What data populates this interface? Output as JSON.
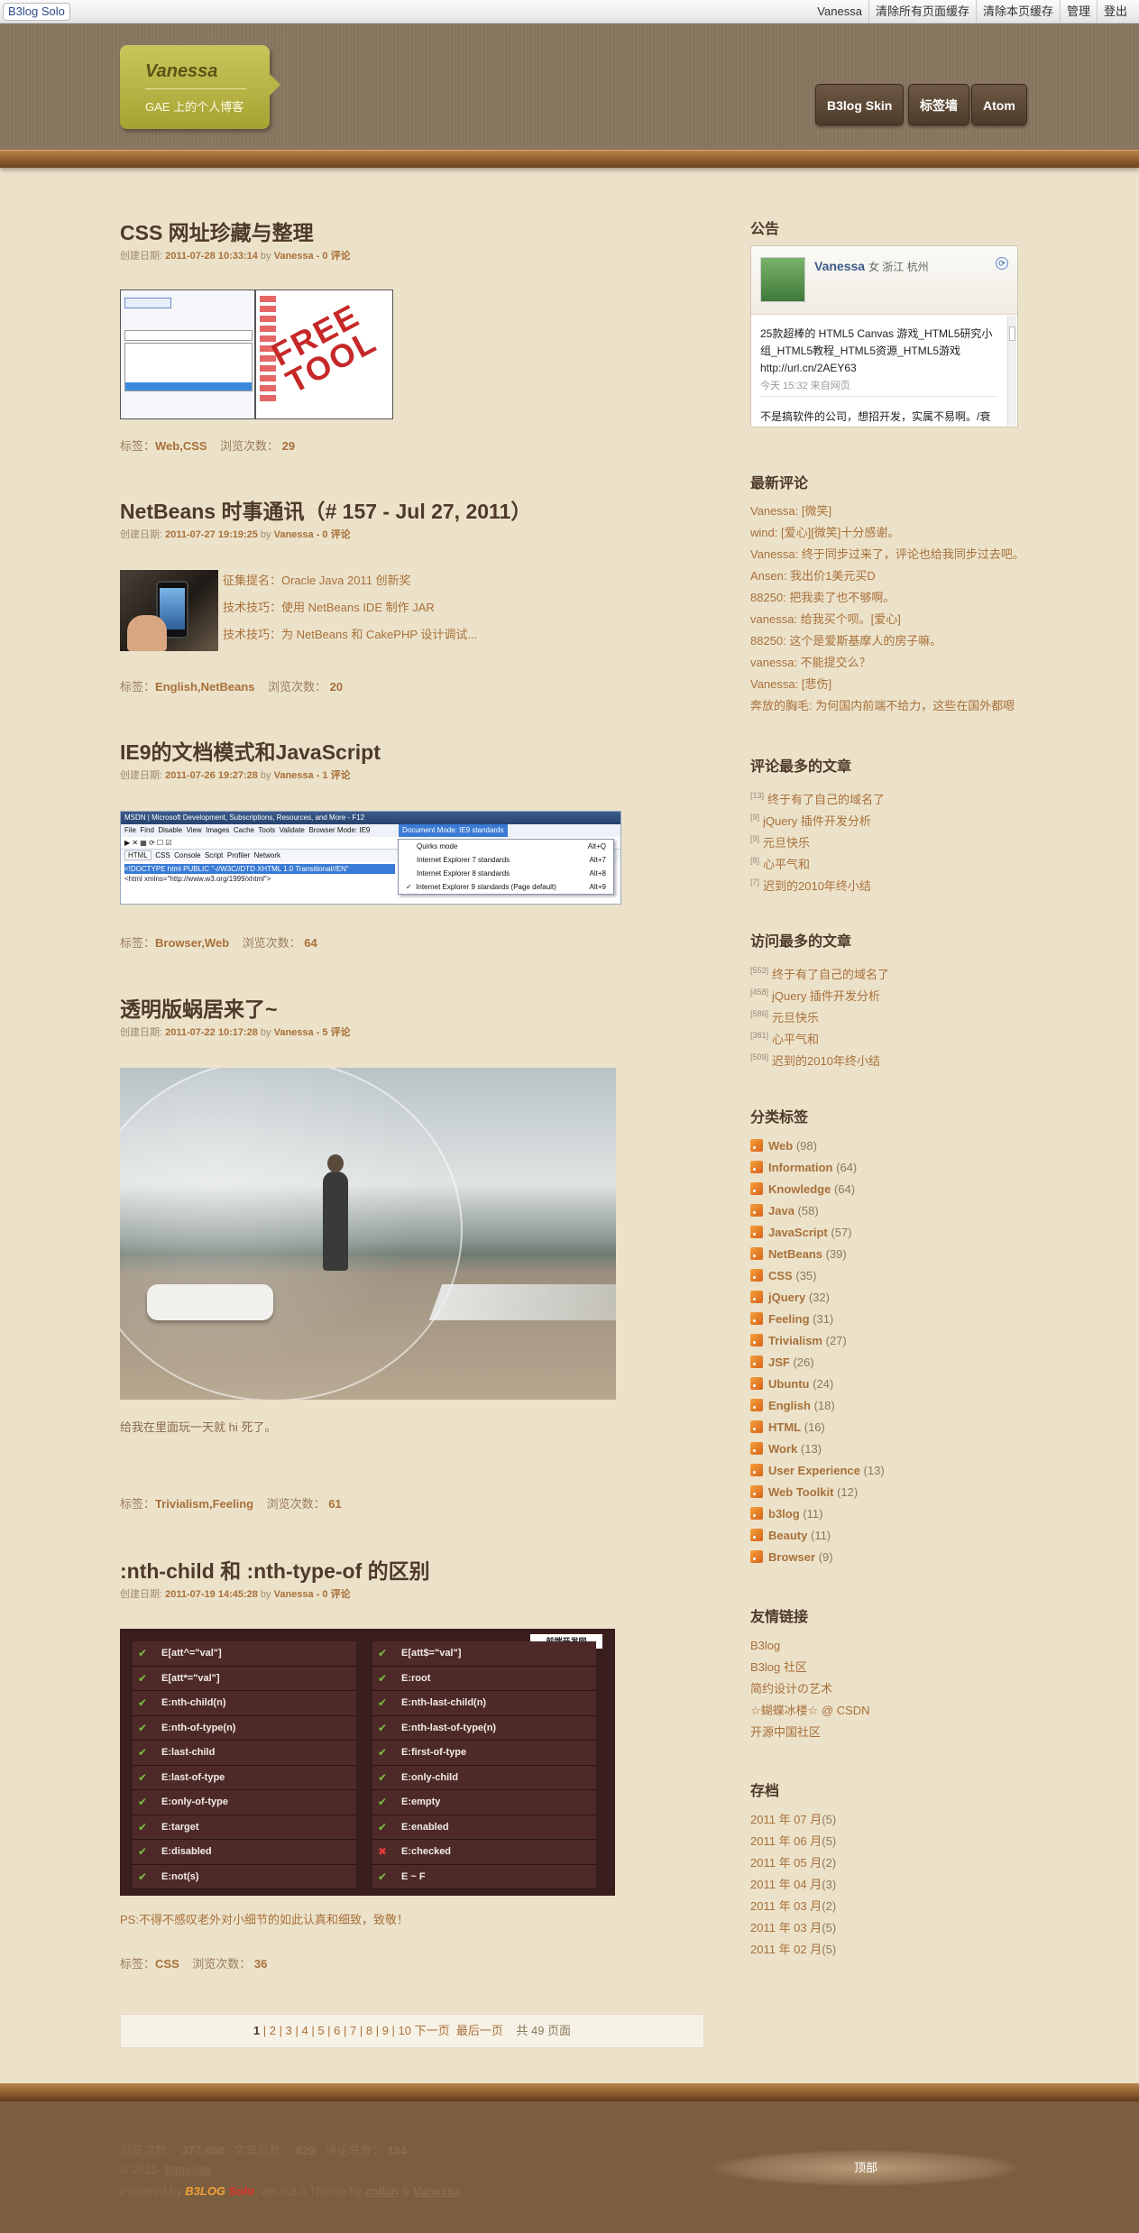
{
  "topbar": {
    "brand": "B3log Solo",
    "links": [
      "Vanessa",
      "清除所有页面缓存",
      "清除本页缓存",
      "管理",
      "登出"
    ]
  },
  "header": {
    "blog_name": "Vanessa",
    "subtitle": "GAE 上的个人博客",
    "nav": [
      "B3log Skin",
      "标签墙",
      "Atom"
    ]
  },
  "posts": [
    {
      "title": "CSS 网址珍藏与整理",
      "meta_prefix": "创建日期: ",
      "date": "2011-07-28 10:33:14",
      "by": " by ",
      "author": "Vanessa",
      "comments": " - 0 评论",
      "tags_label": "标签：",
      "tags": "Web,CSS",
      "views_label": "浏览次数：",
      "views": "29"
    },
    {
      "title": "NetBeans 时事通讯（# 157 - Jul 27, 2011）",
      "meta_prefix": "创建日期: ",
      "date": "2011-07-27 19:19:25",
      "by": " by ",
      "author": "Vanessa",
      "comments": " - 0 评论",
      "items": [
        "征集提名：Oracle Java 2011 创新奖",
        "技术技巧：使用 NetBeans IDE 制作 JAR",
        "技术技巧：为 NetBeans 和 CakePHP 设计调试..."
      ],
      "tags_label": "标签：",
      "tags": "English,NetBeans",
      "views_label": "浏览次数：",
      "views": "20"
    },
    {
      "title": "IE9的文档模式和JavaScript",
      "meta_prefix": "创建日期: ",
      "date": "2011-07-26 19:27:28",
      "by": " by ",
      "author": "Vanessa",
      "comments": " - 1 评论",
      "tags_label": "标签：",
      "tags": "Browser,Web",
      "views_label": "浏览次数：",
      "views": "64",
      "screenshot": {
        "window_title": "MSDN | Microsoft Development, Subscriptions, Resources, and More - F12",
        "menu": [
          "File",
          "Find",
          "Disable",
          "View",
          "Images",
          "Cache",
          "Tools",
          "Validate",
          "Browser Mode: IE9",
          "Document Mode: IE9 standards"
        ],
        "tabs": [
          "HTML",
          "CSS",
          "Console",
          "Script",
          "Profiler",
          "Network"
        ],
        "dropdown": [
          {
            "label": "Quirks mode",
            "key": "Alt+Q"
          },
          {
            "label": "Internet Explorer 7 standards",
            "key": "Alt+7"
          },
          {
            "label": "Internet Explorer 8 standards",
            "key": "Alt+8"
          },
          {
            "label": "Internet Explorer 9 standards (Page default)",
            "key": "Alt+9"
          }
        ],
        "code": [
          "<!DOCTYPE html PUBLIC \"-//W3C//DTD XHTML 1.0 Transitional//EN\"",
          "<html xmlns=\"http://www.w3.org/1999/xhtml\">"
        ]
      }
    },
    {
      "title": "透明版蜗居来了~",
      "meta_prefix": "创建日期: ",
      "date": "2011-07-22 10:17:28",
      "by": " by ",
      "author": "Vanessa",
      "comments": " - 5 评论",
      "body": "给我在里面玩一天就 hi 死了。",
      "tags_label": "标签：",
      "tags": "Trivialism,Feeling",
      "views_label": "浏览次数：",
      "views": "61"
    },
    {
      "title": ":nth-child 和 :nth-type-of 的区别",
      "meta_prefix": "创建日期: ",
      "date": "2011-07-19 14:45:28",
      "by": " by ",
      "author": "Vanessa",
      "comments": " - 0 评论",
      "selectors_left": [
        "E[att^=\"val\"]",
        "E[att*=\"val\"]",
        "E:nth-child(n)",
        "E:nth-of-type(n)",
        "E:last-child",
        "E:last-of-type",
        "E:only-of-type",
        "E:target",
        "E:disabled",
        "E:not(s)"
      ],
      "selectors_right": [
        "E[att$=\"val\"]",
        "E:root",
        "E:nth-last-child(n)",
        "E:nth-last-of-type(n)",
        "E:first-of-type",
        "E:only-child",
        "E:empty",
        "E:enabled",
        "E:checked",
        "E ~ F"
      ],
      "ps": "PS:不得不感叹老外对小细节的如此认真和细致，致敬！",
      "tags_label": "标签：",
      "tags": "CSS",
      "views_label": "浏览次数：",
      "views": "36"
    }
  ],
  "pagination": {
    "current": "1",
    "pages": [
      "2",
      "3",
      "4",
      "5",
      "6",
      "7",
      "8",
      "9",
      "10"
    ],
    "next": "下一页",
    "last": "最后一页",
    "total": "共 49 页面"
  },
  "sidebar": {
    "notice_title": "公告",
    "notice": {
      "name": "Vanessa",
      "info": "女 浙江 杭州",
      "tweet1": "25款超棒的 HTML5 Canvas 游戏_HTML5研究小组_HTML5教程_HTML5资源_HTML5游戏 http://url.cn/2AEY63",
      "tweet1_meta": "今天 15:32 来自网页",
      "tweet2": "不是搞软件的公司，想招开发，实属不易啊。/衰"
    },
    "recent_comments_title": "最新评论",
    "recent_comments": [
      {
        "author": "Vanessa",
        "text": ": [微笑]"
      },
      {
        "author": "wind",
        "text": ": [爱心][微笑]十分感谢。"
      },
      {
        "author": "Vanessa",
        "text": ": 终于同步过来了，评论也给我同步过去吧。"
      },
      {
        "author": "Ansen",
        "text": ": 我出价1美元买D"
      },
      {
        "author": "88250",
        "text": ": 把我卖了也不够啊。"
      },
      {
        "author": "vanessa",
        "text": ": 给我买个呗。[爱心]"
      },
      {
        "author": "88250",
        "text": ": 这个是爱斯基摩人的房子嘛。"
      },
      {
        "author": "vanessa",
        "text": ": 不能提交么？"
      },
      {
        "author": "Vanessa",
        "text": ": [悲伤]"
      },
      {
        "author": "奔放的胸毛",
        "text": ": 为何国内前端不给力，这些在国外都嗯"
      }
    ],
    "most_comment_title": "评论最多的文章",
    "most_comment": [
      {
        "count": "[13]",
        "title": "终于有了自己的域名了"
      },
      {
        "count": "[9]",
        "title": "jQuery 插件开发分析"
      },
      {
        "count": "[9]",
        "title": "元旦快乐"
      },
      {
        "count": "[8]",
        "title": "心平气和"
      },
      {
        "count": "[7]",
        "title": "迟到的2010年终小结"
      }
    ],
    "most_view_title": "访问最多的文章",
    "most_view": [
      {
        "count": "[552]",
        "title": "终于有了自己的域名了"
      },
      {
        "count": "[458]",
        "title": "jQuery 插件开发分析"
      },
      {
        "count": "[586]",
        "title": "元旦快乐"
      },
      {
        "count": "[381]",
        "title": "心平气和"
      },
      {
        "count": "[509]",
        "title": "迟到的2010年终小结"
      }
    ],
    "tags_title": "分类标签",
    "tags": [
      {
        "name": "Web",
        "count": "(98)"
      },
      {
        "name": "Information",
        "count": "(64)"
      },
      {
        "name": "Knowledge",
        "count": "(64)"
      },
      {
        "name": "Java",
        "count": "(58)"
      },
      {
        "name": "JavaScript",
        "count": "(57)"
      },
      {
        "name": "NetBeans",
        "count": "(39)"
      },
      {
        "name": "CSS",
        "count": "(35)"
      },
      {
        "name": "jQuery",
        "count": "(32)"
      },
      {
        "name": "Feeling",
        "count": "(31)"
      },
      {
        "name": "Trivialism",
        "count": "(27)"
      },
      {
        "name": "JSF",
        "count": "(26)"
      },
      {
        "name": "Ubuntu",
        "count": "(24)"
      },
      {
        "name": "English",
        "count": "(18)"
      },
      {
        "name": "HTML",
        "count": "(16)"
      },
      {
        "name": "Work",
        "count": "(13)"
      },
      {
        "name": "User Experience",
        "count": "(13)"
      },
      {
        "name": "Web Toolkit",
        "count": "(12)"
      },
      {
        "name": "b3log",
        "count": "(11)"
      },
      {
        "name": "Beauty",
        "count": "(11)"
      },
      {
        "name": "Browser",
        "count": "(9)"
      }
    ],
    "links_title": "友情链接",
    "links": [
      "B3log",
      "B3log 社区",
      "简约设计の艺术",
      "☆蝴蝶冰楼☆ @ CSDN",
      "开源中国社区"
    ],
    "archive_title": "存档",
    "archive": [
      {
        "label": "2011 年 07 月",
        "count": "(5)"
      },
      {
        "label": "2011 年 06 月",
        "count": "(5)"
      },
      {
        "label": "2011 年 05 月",
        "count": "(2)"
      },
      {
        "label": "2011 年 04 月",
        "count": "(3)"
      },
      {
        "label": "2011 年 03 月",
        "count": "(2)"
      },
      {
        "label": "2011 年 03 月",
        "count": "(5)"
      },
      {
        "label": "2011 年 02 月",
        "count": "(5)"
      }
    ]
  },
  "footer": {
    "views_label": "浏览次数：",
    "views": "377,050",
    "articles_label": "文章总数：",
    "articles": "629",
    "comments_label": "评论总数：",
    "comments": "134",
    "copyright": "© 2011- ",
    "owner": "Vanessa",
    "powered": "Powered by ",
    "b3log": "B3LOG",
    "solo": "Solo",
    "version": ", ver 0.3.0   Theme by ",
    "theme_author": "zoltan",
    "amp": " & ",
    "theme_author2": "Vanessa",
    "top": "顶部"
  },
  "colors": {
    "accent": "#a8703a",
    "title": "#4e3a27",
    "logo_bg": "#b8b445",
    "nav_bg": "#5a4634",
    "footer_bg": "#7b5e3f"
  }
}
